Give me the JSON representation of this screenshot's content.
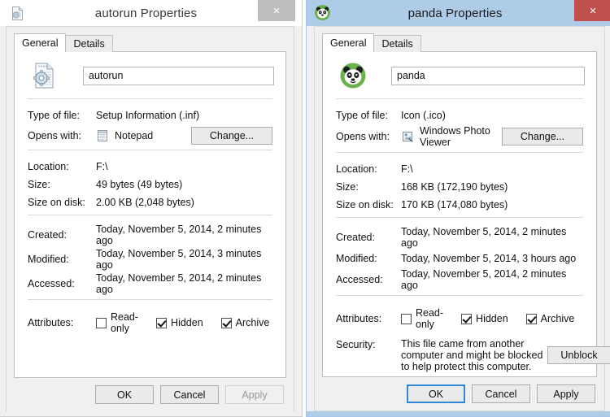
{
  "windows": [
    {
      "id": "autorun",
      "active": false,
      "title": "autorun Properties",
      "title_icon": "inf-file-icon",
      "close_label": "×",
      "tabs": [
        {
          "label": "General",
          "selected": true
        },
        {
          "label": "Details",
          "selected": false
        }
      ],
      "file_icon": "inf-setup-information-icon",
      "filename": "autorun",
      "fields": {
        "type_label": "Type of file:",
        "type_value": "Setup Information (.inf)",
        "opens_label": "Opens with:",
        "opens_app": "Notepad",
        "opens_app_icon": "notepad-icon",
        "change_label": "Change...",
        "location_label": "Location:",
        "location_value": "F:\\",
        "size_label": "Size:",
        "size_value": "49 bytes (49 bytes)",
        "size_on_disk_label": "Size on disk:",
        "size_on_disk_value": "2.00 KB (2,048 bytes)",
        "created_label": "Created:",
        "created_value": "Today, November 5, 2014, 2 minutes ago",
        "modified_label": "Modified:",
        "modified_value": "Today, November 5, 2014, 3 minutes ago",
        "accessed_label": "Accessed:",
        "accessed_value": "Today, November 5, 2014, 2 minutes ago",
        "attributes_label": "Attributes:"
      },
      "attributes": [
        {
          "label": "Read-only",
          "checked": false
        },
        {
          "label": "Hidden",
          "checked": true
        },
        {
          "label": "Archive",
          "checked": true
        }
      ],
      "security": null,
      "footer": {
        "ok": "OK",
        "cancel": "Cancel",
        "apply": "Apply",
        "apply_enabled": false,
        "default_button": "none"
      }
    },
    {
      "id": "panda",
      "active": true,
      "title": "panda Properties",
      "title_icon": "panda-icon",
      "close_label": "×",
      "tabs": [
        {
          "label": "General",
          "selected": true
        },
        {
          "label": "Details",
          "selected": false
        }
      ],
      "file_icon": "panda-icon",
      "filename": "panda",
      "fields": {
        "type_label": "Type of file:",
        "type_value": "Icon (.ico)",
        "opens_label": "Opens with:",
        "opens_app": "Windows Photo Viewer",
        "opens_app_icon": "windows-photo-viewer-icon",
        "change_label": "Change...",
        "location_label": "Location:",
        "location_value": "F:\\",
        "size_label": "Size:",
        "size_value": "168 KB (172,190 bytes)",
        "size_on_disk_label": "Size on disk:",
        "size_on_disk_value": "170 KB (174,080 bytes)",
        "created_label": "Created:",
        "created_value": "Today, November 5, 2014, 2 minutes ago",
        "modified_label": "Modified:",
        "modified_value": "Today, November 5, 2014, 3 hours ago",
        "accessed_label": "Accessed:",
        "accessed_value": "Today, November 5, 2014, 2 minutes ago",
        "attributes_label": "Attributes:"
      },
      "attributes": [
        {
          "label": "Read-only",
          "checked": false
        },
        {
          "label": "Hidden",
          "checked": true
        },
        {
          "label": "Archive",
          "checked": true
        }
      ],
      "security": {
        "label": "Security:",
        "text": "This file came from another computer and might be blocked to help protect this computer.",
        "unblock_label": "Unblock"
      },
      "footer": {
        "ok": "OK",
        "cancel": "Cancel",
        "apply": "Apply",
        "apply_enabled": true,
        "default_button": "ok"
      }
    }
  ],
  "colors": {
    "active_titlebar": "#aecbe8",
    "active_close": "#c0504d",
    "inactive_close": "#bdbdbd",
    "inactive_titlebar": "#ffffff",
    "dialog_bg": "#f0f0f0",
    "page_bg": "#ffffff",
    "focus_blue": "#2e8ad8",
    "panda_green": "#6ab04c"
  }
}
